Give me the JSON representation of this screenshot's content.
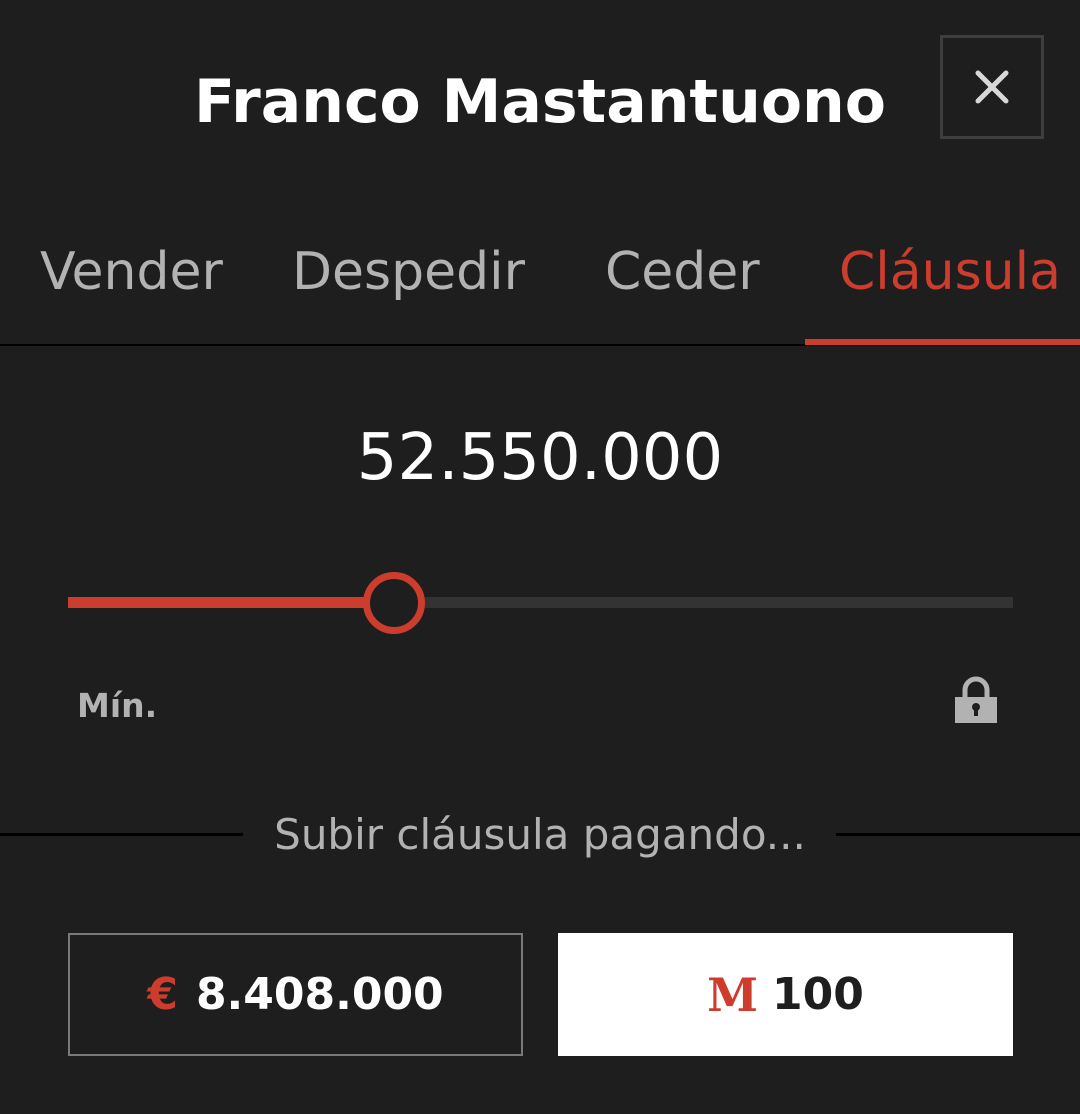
{
  "header": {
    "title": "Franco Mastantuono",
    "close_icon": "close-icon"
  },
  "tabs": [
    {
      "label": "Vender",
      "active": false
    },
    {
      "label": "Despedir",
      "active": false
    },
    {
      "label": "Ceder",
      "active": false
    },
    {
      "label": "Cláusula",
      "active": true
    }
  ],
  "clause": {
    "amount": "52.550.000",
    "slider_level": 0.345,
    "min_label": "Mín.",
    "lock_icon": "lock-icon"
  },
  "raise": {
    "label": "Subir cláusula pagando...",
    "options": [
      {
        "currency_symbol": "€",
        "value": "8.408.000"
      },
      {
        "currency_symbol": "M",
        "value": "100"
      }
    ]
  },
  "colors": {
    "background": "#1f1e1f",
    "accent": "#cc3d2e",
    "muted_text": "#b3b2b3"
  }
}
